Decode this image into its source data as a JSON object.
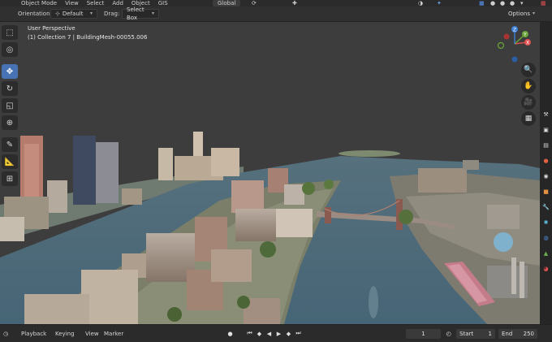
{
  "header": {
    "mode": "Object Mode",
    "menus": [
      "View",
      "Select",
      "Add",
      "Object",
      "GIS"
    ],
    "transform_orientation": "Global"
  },
  "tool_settings": {
    "orientation_label": "Orientation:",
    "orientation_value": "Default",
    "drag_label": "Drag:",
    "drag_value": "Select Box",
    "options_label": "Options"
  },
  "viewport": {
    "view_name": "User Perspective",
    "active_object": "(1) Collection 7 | BuildingMesh-00055.006",
    "gizmo": {
      "x_label": "X",
      "y_label": "Y",
      "z_label": "Z",
      "x_color": "#e0504f",
      "y_color": "#6aa63a",
      "z_color": "#3f7fd6"
    }
  },
  "toolbar_icons": [
    "select-box-icon",
    "cursor-icon",
    "move-icon",
    "rotate-icon",
    "scale-icon",
    "transform-icon",
    "annotate-icon",
    "measure-icon",
    "add-cube-icon"
  ],
  "timeline": {
    "editor_type_icon": "clock-icon",
    "menus": [
      "Playback",
      "Keying",
      "View",
      "Marker"
    ],
    "current_frame": "1",
    "start_label": "Start",
    "start_value": "1",
    "end_label": "End",
    "end_value": "250"
  },
  "colors": {
    "accent": "#4772b3",
    "water": "#4f6f82",
    "background": "#3d3d3d"
  }
}
